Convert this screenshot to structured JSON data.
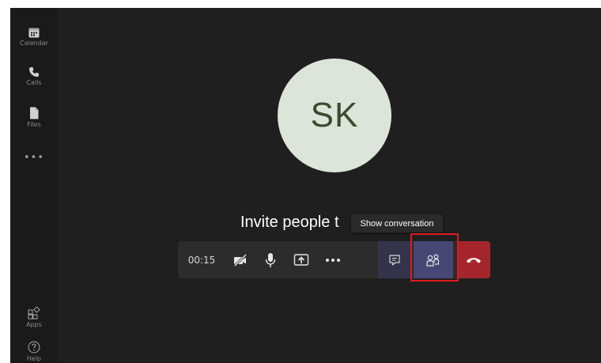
{
  "rail": {
    "items": [
      {
        "label": "Calendar",
        "icon": "calendar-icon"
      },
      {
        "label": "Calls",
        "icon": "phone-icon"
      },
      {
        "label": "Files",
        "icon": "file-icon"
      },
      {
        "label": "•••",
        "icon": "more-icon"
      },
      {
        "label": "Apps",
        "icon": "apps-icon"
      },
      {
        "label": "Help",
        "icon": "help-icon"
      }
    ]
  },
  "call": {
    "avatar_initials": "SK",
    "invite_text": "Invite people t",
    "tooltip": "Show conversation",
    "timer": "00:15"
  },
  "callbar": {
    "buttons": [
      {
        "name": "video-off-button",
        "icon": "camera-off-icon"
      },
      {
        "name": "mic-button",
        "icon": "microphone-icon"
      },
      {
        "name": "share-button",
        "icon": "share-screen-icon"
      },
      {
        "name": "more-actions-button",
        "icon": "more-icon"
      },
      {
        "name": "show-conversation-button",
        "icon": "chat-icon"
      },
      {
        "name": "show-participants-button",
        "icon": "people-icon"
      },
      {
        "name": "hang-up-button",
        "icon": "hang-up-icon"
      }
    ]
  },
  "colors": {
    "rail_bg": "#1a1a1a",
    "stage_bg": "#1f1f1f",
    "avatar_bg": "#dde4d9",
    "hangup": "#a4262c",
    "active": "#464775",
    "highlight": "#e0191f"
  }
}
